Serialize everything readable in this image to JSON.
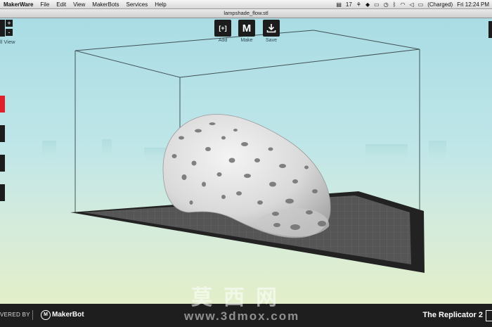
{
  "menubar": {
    "app_name": "MakerWare",
    "menus": [
      "File",
      "Edit",
      "View",
      "MakerBots",
      "Services",
      "Help"
    ],
    "status": {
      "notification_count": "17",
      "battery_status": "(Charged)",
      "clock": "Fri 12:24 PM"
    }
  },
  "window": {
    "title": "lampshade_flow.stl"
  },
  "toolbar": {
    "add_label": "Add",
    "make_label": "Make",
    "save_label": "Save",
    "add_icon": "[+]",
    "make_icon": "M",
    "save_icon": "download-icon"
  },
  "left_controls": {
    "view_label": "ll View",
    "zoom_in": "+",
    "zoom_out": "-"
  },
  "bottombar": {
    "powered_by": "VERED BY",
    "brand": "MakerBot",
    "device": "The Replicator 2"
  },
  "watermark": {
    "chinese": "莫西网",
    "url": "www.3dmox.com"
  },
  "colors": {
    "accent_red": "#e0202a",
    "toolbar_dark": "#1c1c1c",
    "bottombar": "#1e1e1e"
  }
}
